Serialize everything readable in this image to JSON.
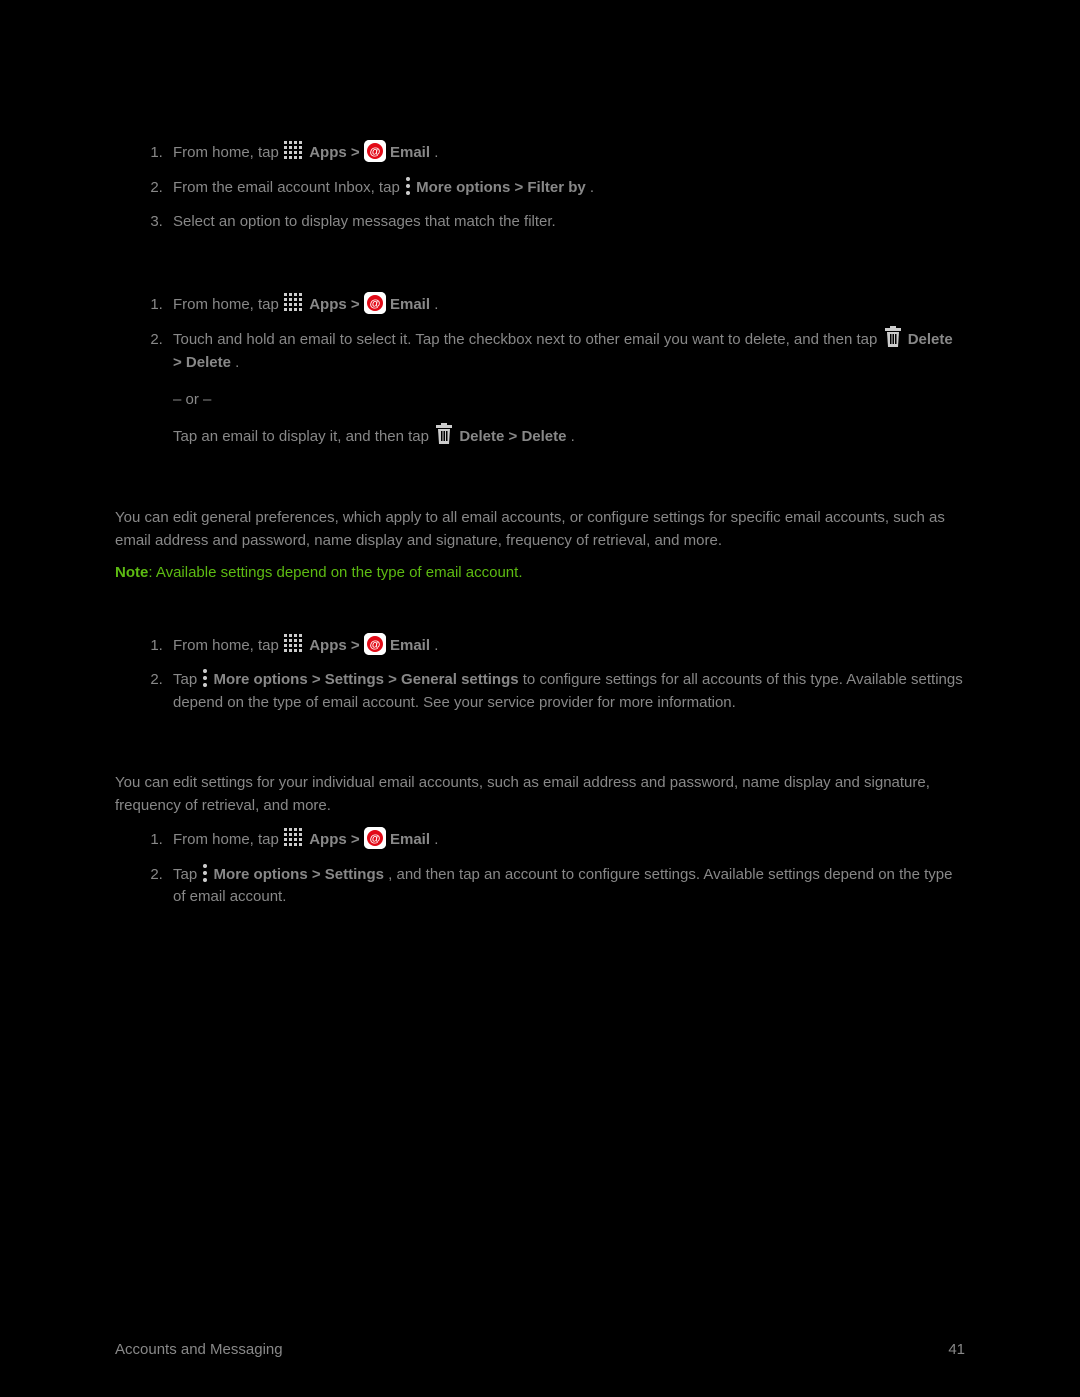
{
  "common": {
    "from_home_tap": "From home, tap ",
    "apps": " Apps",
    "gt": " > ",
    "email": " Email",
    "period": "."
  },
  "section1": {
    "step2_a": "From the email account Inbox, tap ",
    "step2_b": " More options > Filter by",
    "step3": "Select an option to display messages that match the filter."
  },
  "section2": {
    "step2_a": "Touch and hold an email to select it. Tap the checkbox next to other email you want to delete, and then tap ",
    "step2_b": " Delete > Delete",
    "or": "– or –",
    "step2_c": "Tap an email to display it, and then tap ",
    "step2_d": " Delete > Delete"
  },
  "section3": {
    "intro": "You can edit general preferences, which apply to all email accounts, or configure settings for specific email accounts, such as email address and password, name display and signature, frequency of retrieval, and more.",
    "note_label": "Note",
    "note_text": ": Available settings depend on the type of email account.",
    "step2_a": "Tap ",
    "step2_b": " More options > Settings > General settings",
    "step2_c": " to configure settings for all accounts of this type. Available settings depend on the type of email account. See your service provider for more information."
  },
  "section4": {
    "intro": "You can edit settings for your individual email accounts, such as email address and password, name display and signature, frequency of retrieval, and more.",
    "step2_a": "Tap ",
    "step2_b": " More options > Settings",
    "step2_c": ", and then tap an account to configure settings. Available settings depend on the type of email account."
  },
  "footer": {
    "left": "Accounts and Messaging",
    "right": "41"
  }
}
